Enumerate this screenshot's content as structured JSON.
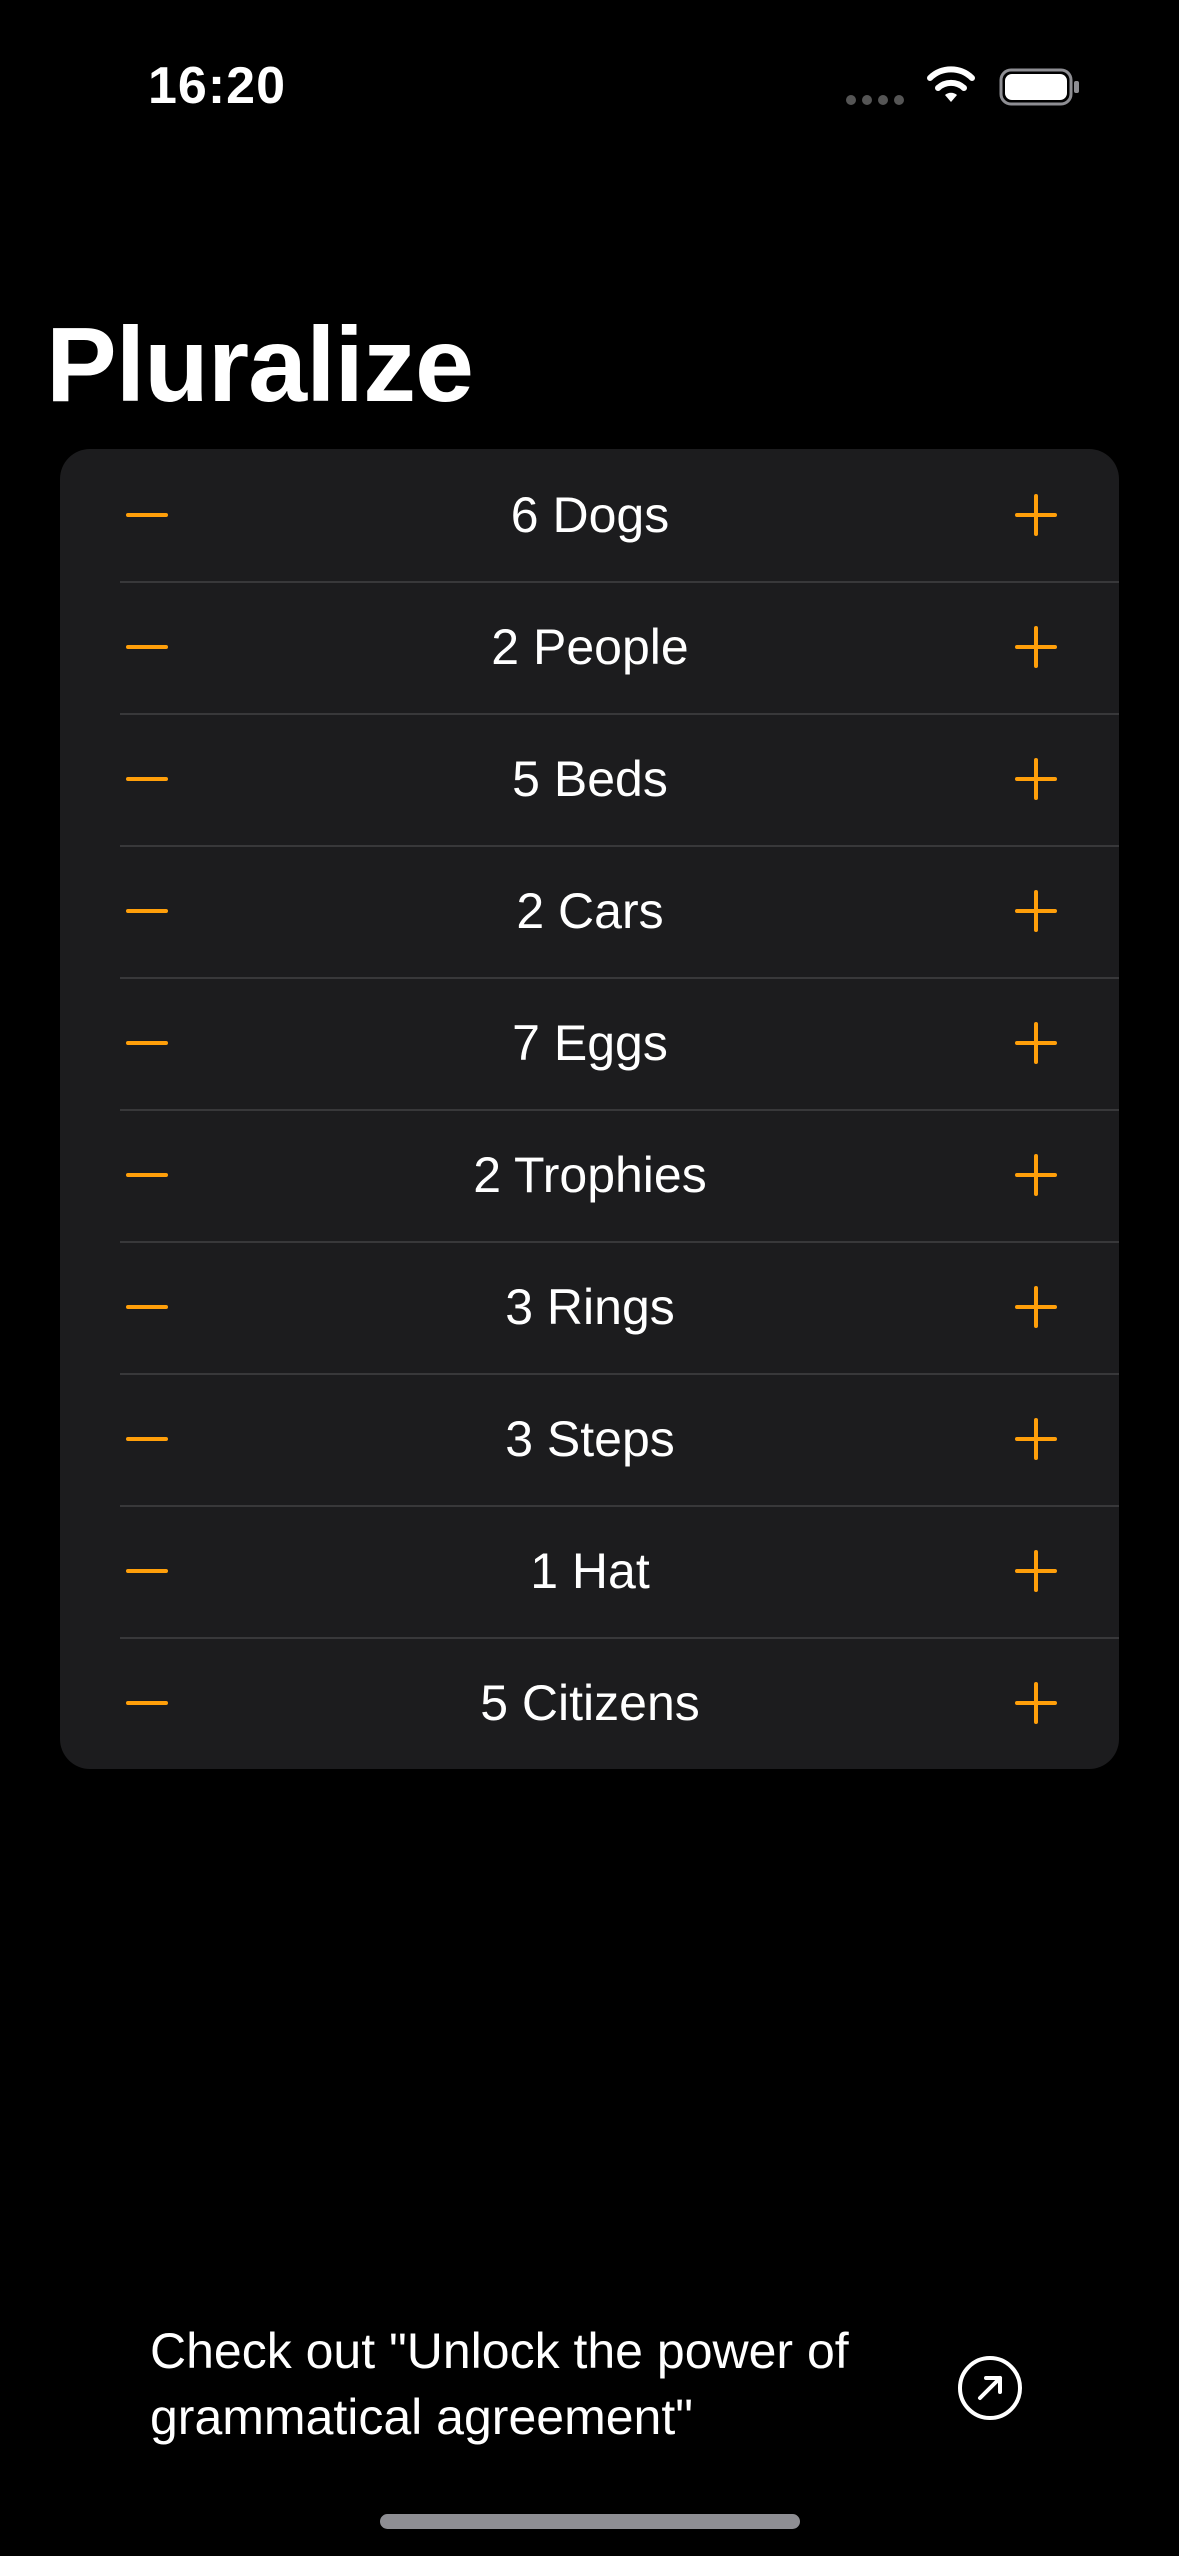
{
  "status_bar": {
    "time": "16:20",
    "icons": [
      "cellular-dots-icon",
      "wifi-icon",
      "battery-icon"
    ]
  },
  "title": "Pluralize",
  "accent_color": "#ff9f0a",
  "items": [
    {
      "label": "6 Dogs",
      "count": 6
    },
    {
      "label": "2 People",
      "count": 2
    },
    {
      "label": "5 Beds",
      "count": 5
    },
    {
      "label": "2 Cars",
      "count": 2
    },
    {
      "label": "7 Eggs",
      "count": 7
    },
    {
      "label": "2 Trophies",
      "count": 2
    },
    {
      "label": "3 Rings",
      "count": 3
    },
    {
      "label": "3 Steps",
      "count": 3
    },
    {
      "label": "1 Hat",
      "count": 1
    },
    {
      "label": "5 Citizens",
      "count": 5
    }
  ],
  "footer": {
    "link_text": "Check out \"Unlock the power of grammatical agreement\"",
    "icon": "external-link-icon"
  }
}
